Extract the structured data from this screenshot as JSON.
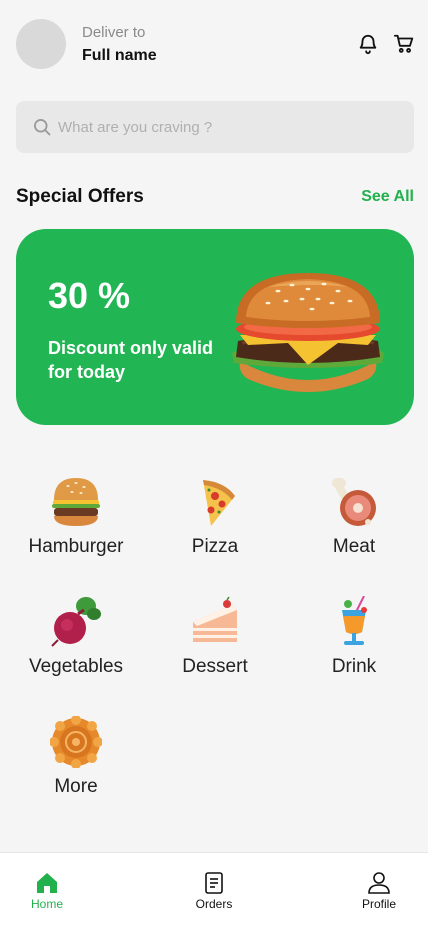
{
  "header": {
    "deliver_label": "Deliver to",
    "full_name": "Full name",
    "bell_icon": "bell-icon",
    "cart_icon": "cart-icon"
  },
  "search": {
    "placeholder": "What are you craving ?",
    "value": ""
  },
  "special_offers": {
    "title": "Special Offers",
    "see_all": "See All"
  },
  "banner": {
    "percent": "30 %",
    "text": "Discount only valid for today",
    "color": "#22b553"
  },
  "categories": [
    {
      "label": "Hamburger",
      "icon": "hamburger-icon"
    },
    {
      "label": "Pizza",
      "icon": "pizza-icon"
    },
    {
      "label": "Meat",
      "icon": "meat-icon"
    },
    {
      "label": "Vegetables",
      "icon": "vegetables-icon"
    },
    {
      "label": "Dessert",
      "icon": "dessert-icon"
    },
    {
      "label": "Drink",
      "icon": "drink-icon"
    },
    {
      "label": "More",
      "icon": "more-icon"
    }
  ],
  "nav": {
    "items": [
      {
        "label": "Home",
        "icon": "home-icon",
        "active": true
      },
      {
        "label": "Orders",
        "icon": "orders-icon",
        "active": false
      },
      {
        "label": "Profile",
        "icon": "profile-icon",
        "active": false
      }
    ],
    "active_color": "#22b14c"
  },
  "colors": {
    "accent": "#22b14c",
    "background": "#f5f5f5"
  }
}
